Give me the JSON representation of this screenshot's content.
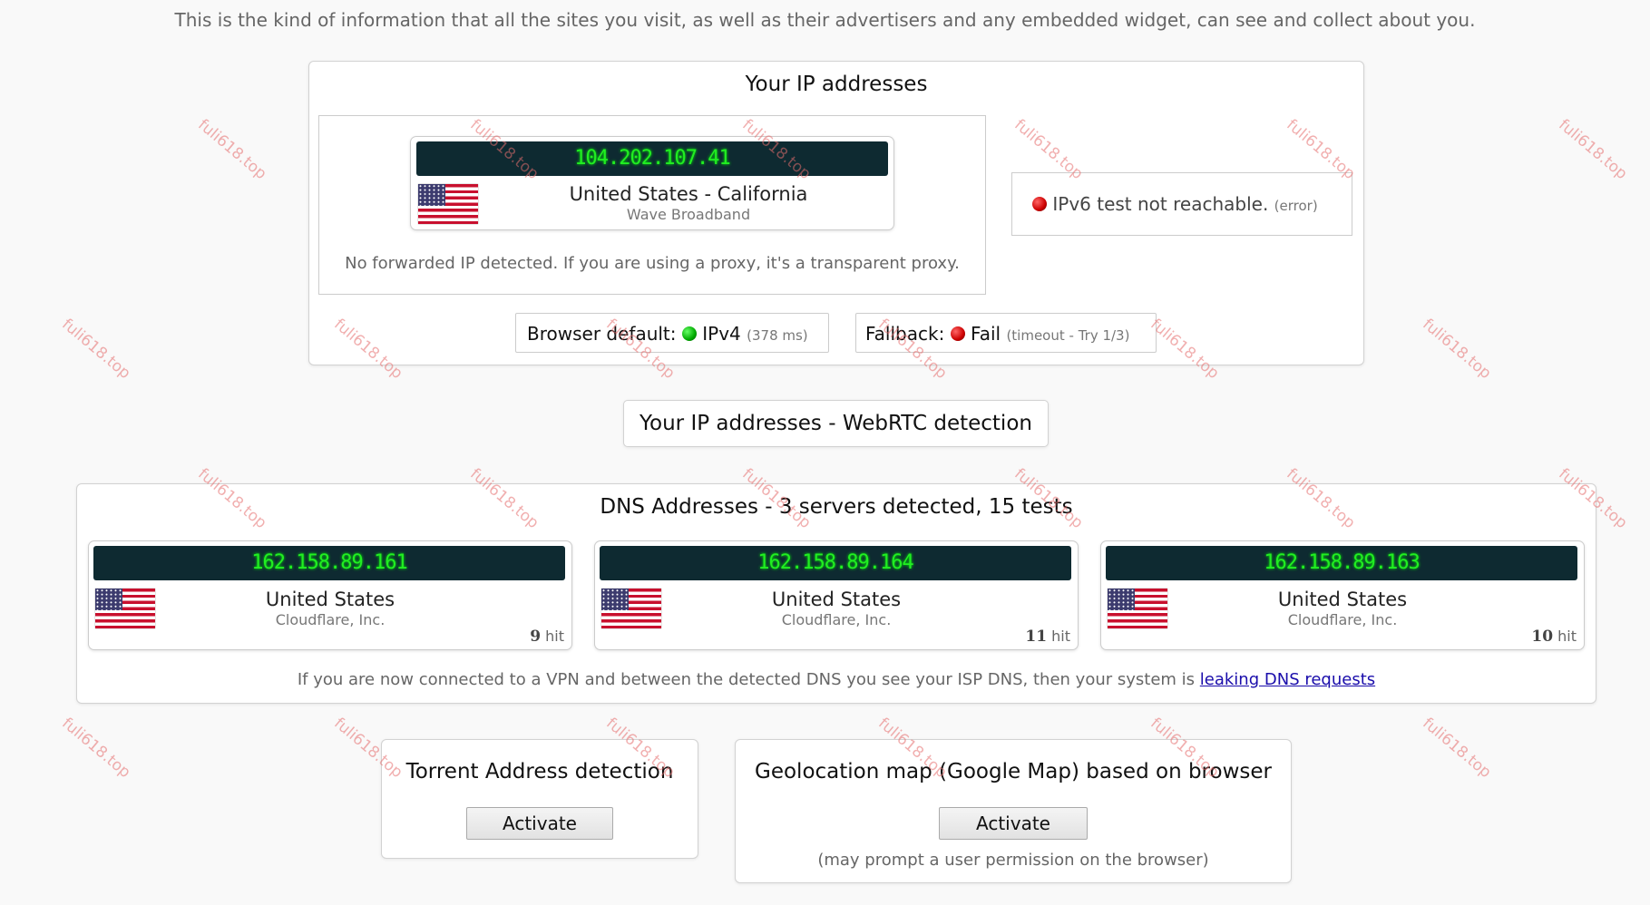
{
  "intro_text": "This is the kind of information that all the sites you visit, as well as their advertisers and any embedded widget, can see and collect about you.",
  "ip_section": {
    "title": "Your IP addresses",
    "ip": "104.202.107.41",
    "location": "United States - California",
    "isp": "Wave Broadband",
    "forwarded_note": "No forwarded IP detected. If you are using a proxy, it's a transparent proxy.",
    "ipv6_status": "IPv6 test not reachable.",
    "ipv6_error": "(error)",
    "browser_default_label": "Browser default:",
    "browser_default_value": "IPv4",
    "browser_default_time": "(378 ms)",
    "fallback_label": "Fallback:",
    "fallback_value": "Fail",
    "fallback_detail": "(timeout - Try 1/3)"
  },
  "webrtc_button_label": "Your IP addresses - WebRTC detection",
  "dns_section": {
    "title": "DNS Addresses - 3 servers detected, 15 tests",
    "servers": [
      {
        "ip": "162.158.89.161",
        "country": "United States",
        "isp": "Cloudflare, Inc.",
        "hits": "9",
        "hit_label": "hit"
      },
      {
        "ip": "162.158.89.164",
        "country": "United States",
        "isp": "Cloudflare, Inc.",
        "hits": "11",
        "hit_label": "hit"
      },
      {
        "ip": "162.158.89.163",
        "country": "United States",
        "isp": "Cloudflare, Inc.",
        "hits": "10",
        "hit_label": "hit"
      }
    ],
    "leak_note": "If you are now connected to a VPN and between the detected DNS you see your ISP DNS, then your system is",
    "leak_link": "leaking DNS requests"
  },
  "torrent": {
    "title": "Torrent Address detection",
    "button": "Activate"
  },
  "geolocation": {
    "title": "Geolocation map (Google Map) based on browser",
    "button": "Activate",
    "note": "(may prompt a user permission on the browser)"
  },
  "watermark": "fuli618.top",
  "colors": {
    "ip_bar_bg": "#0e2a31",
    "ip_text": "#22ee22",
    "status_ok": "#00aa00",
    "status_error": "#cc0000",
    "link": "#1a0dab"
  }
}
